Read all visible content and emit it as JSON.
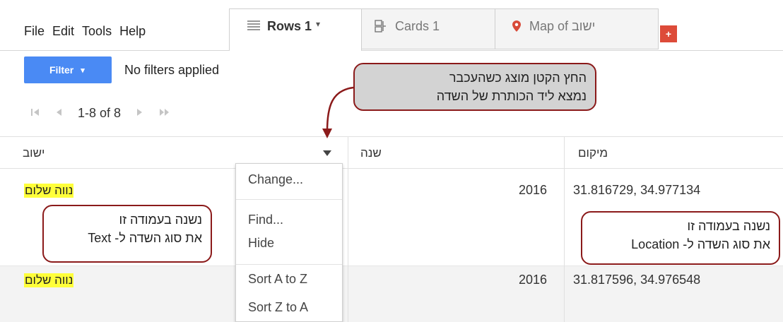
{
  "menu": {
    "file": "File",
    "edit": "Edit",
    "tools": "Tools",
    "help": "Help"
  },
  "tabs": {
    "rows": {
      "label": "Rows 1",
      "caret": "▾"
    },
    "cards": {
      "label": "Cards 1"
    },
    "map": {
      "label": "Map of ישוב"
    },
    "add": "+"
  },
  "filter": {
    "button_label": "Filter",
    "caret": "▾",
    "status": "No filters applied"
  },
  "pager": {
    "range": "1-8 of 8"
  },
  "table": {
    "headers": {
      "yeshuv": "ישוב",
      "shana": "שנה",
      "mikum": "מיקום"
    },
    "rows": [
      {
        "yeshuv": "נווה שלום",
        "year": "2016",
        "location": "31.816729, 34.977134"
      },
      {
        "yeshuv": "נווה שלום",
        "year": "2016",
        "location": "31.817596, 34.976548"
      }
    ]
  },
  "column_menu": {
    "change": "Change...",
    "find": "Find...",
    "hide": "Hide",
    "sort_az": "Sort A to Z",
    "sort_za": "Sort Z to A"
  },
  "callouts": {
    "top": {
      "line1": "החץ הקטן מוצג כשהעכבר",
      "line2": "נמצא ליד הכותרת של השדה"
    },
    "left": {
      "line1": "נשנה בעמודה זו",
      "line2": "את סוג השדה ל- Text"
    },
    "right": {
      "line1": "נשנה בעמודה זו",
      "line2": "את סוג השדה ל- Location"
    }
  },
  "colors": {
    "accent_blue": "#4a8af4",
    "add_tab_red": "#dd4b39",
    "highlight_yellow": "#ffff3a",
    "callout_border": "#8b1a1a"
  },
  "icons": {
    "rows_tab": "list-icon",
    "cards_tab": "cards-icon",
    "map_tab": "map-pin-icon",
    "pager_first": "first-page-icon",
    "pager_prev": "prev-page-icon",
    "pager_next": "next-page-icon",
    "pager_last": "last-page-icon",
    "column_dropdown": "dropdown-arrow-icon"
  }
}
